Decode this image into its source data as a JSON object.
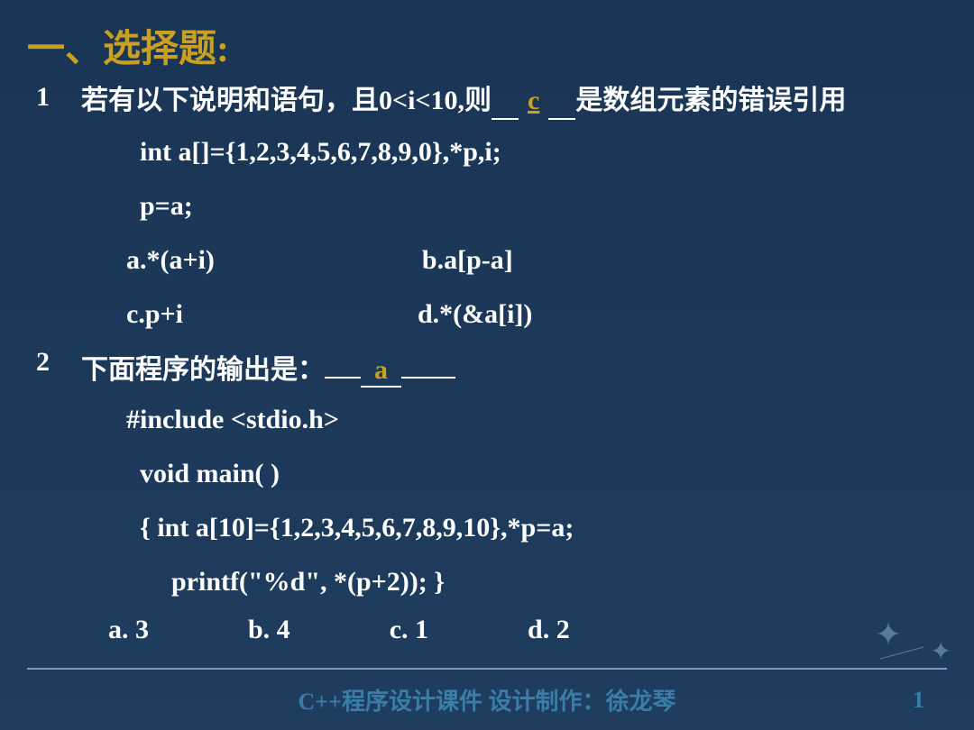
{
  "heading": "一、选择题:",
  "q1": {
    "num": "1",
    "text_before": "若有以下说明和语句，且0<i<10,则",
    "answer": "c",
    "text_after": "是数组元素的错误引用",
    "code1": "int a[]={1,2,3,4,5,6,7,8,9,0},*p,i;",
    "code2": "p=a;",
    "opt_a": "a.*(a+i)",
    "opt_b": "b.a[p-a]",
    "opt_c": "c.p+i",
    "opt_d": "d.*(&a[i])"
  },
  "q2": {
    "num": "2",
    "text": "下面程序的输出是：",
    "answer": "a",
    "code1": "#include <stdio.h>",
    "code2": "void main( )",
    "code3": "{  int a[10]={1,2,3,4,5,6,7,8,9,10},*p=a;",
    "code4": "printf(\"%d\", *(p+2)); }",
    "opt_a": "a. 3",
    "opt_b": "b. 4",
    "opt_c": "c. 1",
    "opt_d": "d. 2"
  },
  "footer": "C++程序设计课件    设计制作：徐龙琴",
  "page_num": "1"
}
